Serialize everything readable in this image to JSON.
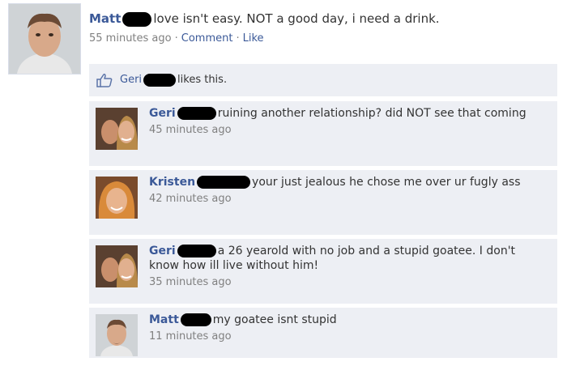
{
  "post": {
    "author": "Matt",
    "text": "love isn't easy. NOT a good day, i need a drink.",
    "time": "55 minutes ago",
    "separator": "·",
    "comment_link": "Comment",
    "like_link": "Like"
  },
  "likes": {
    "who": "Geri",
    "text": "likes this."
  },
  "comments": [
    {
      "author": "Geri",
      "text": "ruining another relationship? did NOT see that coming",
      "time": "45 minutes ago"
    },
    {
      "author": "Kristen",
      "text": "your just jealous he chose me over ur fugly ass",
      "time": "42 minutes ago"
    },
    {
      "author": "Geri",
      "text": "a 26 yearold with no job and a stupid goatee. I don't know how ill live without him!",
      "time": "35 minutes ago"
    },
    {
      "author": "Matt",
      "text": "my goatee isnt stupid",
      "time": "11 minutes ago"
    }
  ],
  "colors": {
    "link": "#3b5998",
    "feedback_bg": "#edeff4",
    "meta_gray": "#808080"
  },
  "icons": {
    "like": "thumbs-up-icon"
  }
}
